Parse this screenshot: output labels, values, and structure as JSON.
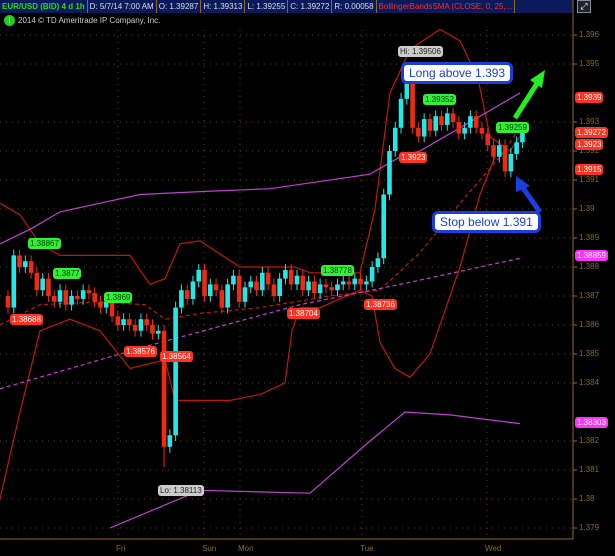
{
  "header": {
    "symbol": "EUR/USD (BID) 4 d 1h",
    "date": "D: 5/7/14 7:00 AM",
    "open": "O: 1.39287",
    "high": "H: 1.39313",
    "low": "L: 1.39255",
    "close": "C: 1.39272",
    "range": "R: 0.00058",
    "study": "BollingerBandsSMA (CLOSE, 0, 25,..."
  },
  "copyright": "2014 © TD Ameritrade IP Company, Inc.",
  "annotations": {
    "long": "Long above 1.393",
    "stop": "Stop below 1.391"
  },
  "bubbles": {
    "hi": "Hi: 1.39506",
    "lo": "Lo: 1.38113",
    "g1": "1.38867",
    "g2": "1.3877",
    "g3": "1.3869",
    "g4": "1.38778",
    "g5": "1.39352",
    "g6": "1.39259",
    "r1": "1.38688",
    "r2": "1.38576",
    "r3": "1.38564",
    "r4": "1.38704",
    "r5": "1.38736",
    "r6": "1.3923"
  },
  "price_labels": {
    "a": "1.3939",
    "b": "1.39272",
    "c": "1.3923",
    "d": "1.3915",
    "e": "1.38859",
    "f": "1.38303"
  },
  "colors": {
    "up": "#22e8e8",
    "down": "#f02a10",
    "band": "#c01808",
    "sma": "#c040d0"
  },
  "chart_data": {
    "type": "candlestick",
    "ylim": [
      1.379,
      1.3965
    ],
    "yticks": [
      "1.396",
      "1.395",
      "1.393",
      "1.392",
      "1.391",
      "1.39",
      "1.389",
      "1.388",
      "1.387",
      "1.386",
      "1.385",
      "1.384",
      "1.382",
      "1.381",
      "1.38",
      "1.379"
    ],
    "xticks": [
      "Fri",
      "Sun",
      "Mon",
      "Tue",
      "Wed"
    ],
    "first_open": 1.387,
    "closes": [
      1.3866,
      1.3884,
      1.388,
      1.3882,
      1.3878,
      1.3872,
      1.3876,
      1.387,
      1.3868,
      1.3872,
      1.3867,
      1.387,
      1.3869,
      1.3872,
      1.3871,
      1.3868,
      1.3866,
      1.3868,
      1.3863,
      1.386,
      1.3862,
      1.386,
      1.3858,
      1.3862,
      1.386,
      1.3857,
      1.3858,
      1.3818,
      1.3822,
      1.3866,
      1.3872,
      1.3869,
      1.3875,
      1.3879,
      1.387,
      1.3874,
      1.3872,
      1.3866,
      1.3874,
      1.3877,
      1.3868,
      1.3873,
      1.3875,
      1.3872,
      1.3878,
      1.3874,
      1.387,
      1.3876,
      1.3879,
      1.3874,
      1.3877,
      1.3872,
      1.3875,
      1.3871,
      1.3874,
      1.3873,
      1.3872,
      1.3874,
      1.3875,
      1.3874,
      1.3876,
      1.3874,
      1.3875,
      1.388,
      1.3883,
      1.3905,
      1.392,
      1.3928,
      1.3938,
      1.3945,
      1.3928,
      1.3925,
      1.3931,
      1.3927,
      1.3932,
      1.3929,
      1.3933,
      1.393,
      1.3926,
      1.3928,
      1.3932,
      1.3928,
      1.3926,
      1.3922,
      1.3918,
      1.3922,
      1.3913,
      1.3919,
      1.3923,
      1.3927
    ],
    "low_override": {
      "27": 1.3811
    },
    "high_override": {
      "69": 1.395
    },
    "series": [
      {
        "name": "upper_band",
        "style": "band",
        "points": [
          [
            0,
            1.3902
          ],
          [
            20,
            1.3898
          ],
          [
            40,
            1.3888
          ],
          [
            60,
            1.3884
          ],
          [
            130,
            1.3884
          ],
          [
            150,
            1.3874
          ],
          [
            165,
            1.3876
          ],
          [
            180,
            1.3888
          ],
          [
            200,
            1.3889
          ],
          [
            240,
            1.388
          ],
          [
            295,
            1.388
          ],
          [
            310,
            1.3878
          ],
          [
            360,
            1.3878
          ],
          [
            375,
            1.39
          ],
          [
            390,
            1.394
          ],
          [
            410,
            1.3955
          ],
          [
            440,
            1.3962
          ],
          [
            460,
            1.3958
          ],
          [
            478,
            1.3945
          ],
          [
            490,
            1.3925
          ],
          [
            510,
            1.392
          ],
          [
            520,
            1.3925
          ]
        ]
      },
      {
        "name": "lower_band",
        "style": "band",
        "points": [
          [
            0,
            1.38
          ],
          [
            20,
            1.383
          ],
          [
            40,
            1.3858
          ],
          [
            70,
            1.3862
          ],
          [
            100,
            1.3858
          ],
          [
            130,
            1.3845
          ],
          [
            165,
            1.3848
          ],
          [
            175,
            1.3834
          ],
          [
            230,
            1.3834
          ],
          [
            260,
            1.3836
          ],
          [
            285,
            1.384
          ],
          [
            292,
            1.3858
          ],
          [
            300,
            1.3866
          ],
          [
            320,
            1.3866
          ],
          [
            360,
            1.3872
          ],
          [
            372,
            1.387
          ],
          [
            380,
            1.3854
          ],
          [
            395,
            1.3845
          ],
          [
            410,
            1.3842
          ],
          [
            430,
            1.385
          ],
          [
            460,
            1.388
          ],
          [
            480,
            1.3905
          ],
          [
            495,
            1.3918
          ]
        ]
      },
      {
        "name": "middle_band",
        "style": "dashred",
        "points": [
          [
            0,
            1.386
          ],
          [
            40,
            1.3867
          ],
          [
            100,
            1.3868
          ],
          [
            145,
            1.3867
          ],
          [
            165,
            1.3862
          ],
          [
            200,
            1.3864
          ],
          [
            260,
            1.3866
          ],
          [
            330,
            1.387
          ],
          [
            380,
            1.3872
          ],
          [
            420,
            1.3885
          ],
          [
            460,
            1.3902
          ],
          [
            500,
            1.3918
          ],
          [
            520,
            1.3928
          ]
        ]
      },
      {
        "name": "sma_upper",
        "style": "sma",
        "points": [
          [
            0,
            1.3888
          ],
          [
            30,
            1.3893
          ],
          [
            60,
            1.3899
          ],
          [
            100,
            1.3902
          ],
          [
            140,
            1.3905
          ],
          [
            200,
            1.3906
          ],
          [
            270,
            1.3907
          ],
          [
            370,
            1.3912
          ],
          [
            400,
            1.3918
          ],
          [
            420,
            1.392
          ],
          [
            460,
            1.3928
          ],
          [
            500,
            1.3936
          ],
          [
            520,
            1.394
          ]
        ]
      },
      {
        "name": "sma_mid",
        "style": "dashsma",
        "points": [
          [
            0,
            1.3838
          ],
          [
            150,
            1.3853
          ],
          [
            300,
            1.3867
          ],
          [
            400,
            1.3874
          ],
          [
            520,
            1.3883
          ]
        ]
      },
      {
        "name": "sma_lower",
        "style": "sma",
        "points": [
          [
            110,
            1.379
          ],
          [
            200,
            1.3803
          ],
          [
            310,
            1.3802
          ],
          [
            370,
            1.382
          ],
          [
            405,
            1.383
          ],
          [
            450,
            1.3829
          ],
          [
            520,
            1.3826
          ]
        ]
      }
    ]
  }
}
